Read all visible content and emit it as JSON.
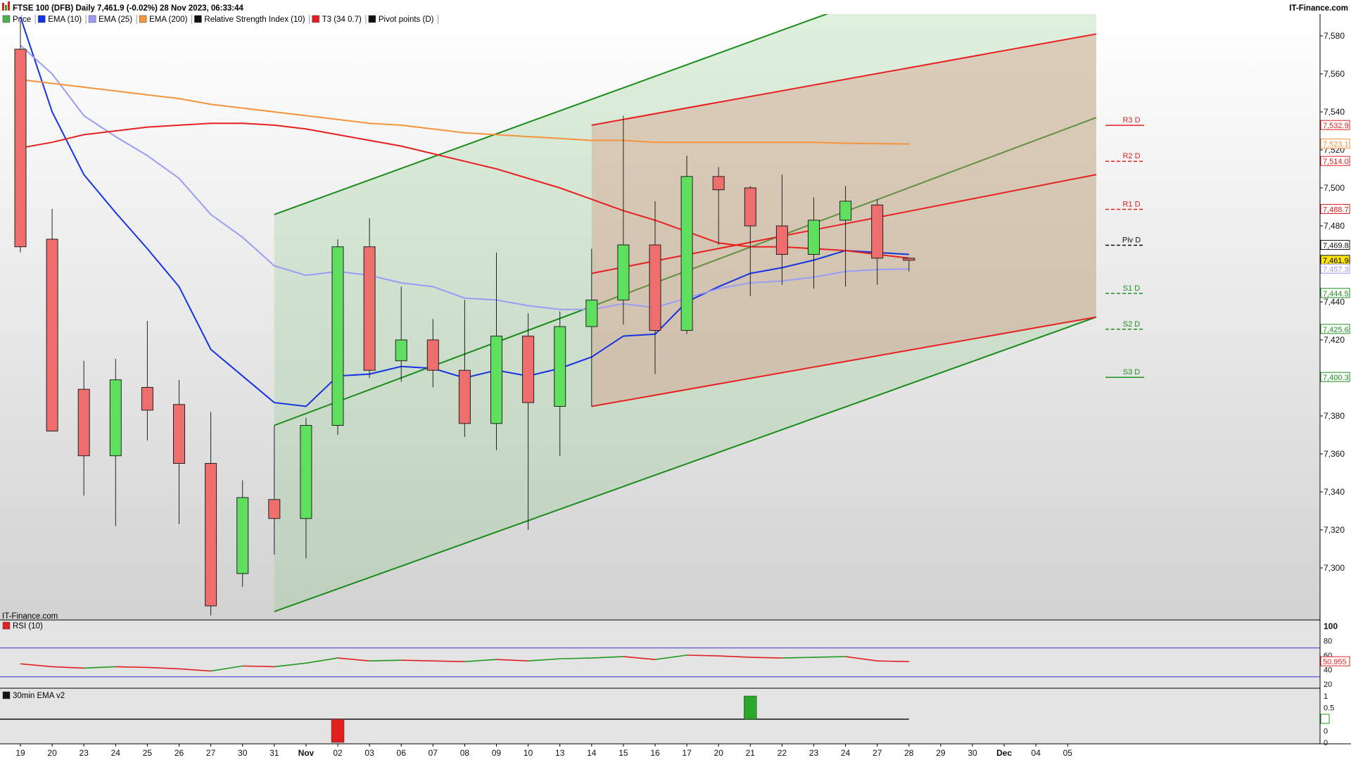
{
  "header": {
    "title": "FTSE 100 (DFB) Daily 7,461.9 (-0.02%) 28 Nov 2023, 06:33:44",
    "brand": "IT-Finance.com",
    "watermark": "IT-Finance.com"
  },
  "legend": [
    {
      "label": "Price",
      "color": "#4caf50"
    },
    {
      "label": "EMA (10)",
      "color": "#1533e0"
    },
    {
      "label": "EMA (25)",
      "color": "#9a9cf5"
    },
    {
      "label": "EMA (200)",
      "color": "#f5943a"
    },
    {
      "label": "Relative Strength Index (10)",
      "color": "#111111"
    },
    {
      "label": "T3 (34 0.7)",
      "color": "#e02020"
    },
    {
      "label": "Pivot points (D)",
      "color": "#111111"
    }
  ],
  "colors": {
    "up": "#5ee05e",
    "down": "#ee6e6e",
    "ema10": "#1533e0",
    "ema25": "#9a9cf5",
    "ema200": "#f5943a",
    "channel_green": "#1a8c1a",
    "channel_red": "#e82020",
    "panel_bg": "#d9d9d9"
  },
  "chart_data": [
    {
      "type": "candlestick",
      "panel": "price",
      "ylim": [
        7280,
        7600
      ],
      "y_ticks": [
        7300,
        7320,
        7340,
        7360,
        7380,
        7400,
        7420,
        7440,
        7460,
        7480,
        7500,
        7520,
        7540,
        7560,
        7580
      ],
      "y_tick_labels": [
        "7,300",
        "7,320",
        "7,340",
        "7,360",
        "7,380",
        "7,400",
        "7,420",
        "7,440",
        "7,460",
        "7,480",
        "7,500",
        "7,520",
        "7,540",
        "7,560",
        "7,580"
      ],
      "x_labels": [
        "19",
        "20",
        "23",
        "24",
        "25",
        "26",
        "27",
        "30",
        "31",
        "Nov",
        "02",
        "03",
        "06",
        "07",
        "08",
        "09",
        "10",
        "13",
        "14",
        "15",
        "16",
        "17",
        "20",
        "21",
        "22",
        "23",
        "24",
        "27",
        "28",
        "29",
        "30",
        "Dec",
        "04",
        "05"
      ],
      "candles": [
        {
          "o": 7573,
          "h": 7588,
          "l": 7466,
          "c": 7469
        },
        {
          "o": 7473,
          "h": 7489,
          "l": 7372,
          "c": 7372
        },
        {
          "o": 7394,
          "h": 7409,
          "l": 7338,
          "c": 7359
        },
        {
          "o": 7359,
          "h": 7410,
          "l": 7322,
          "c": 7399
        },
        {
          "o": 7395,
          "h": 7430,
          "l": 7367,
          "c": 7383
        },
        {
          "o": 7386,
          "h": 7399,
          "l": 7323,
          "c": 7355
        },
        {
          "o": 7355,
          "h": 7382,
          "l": 7275,
          "c": 7280
        },
        {
          "o": 7297,
          "h": 7346,
          "l": 7290,
          "c": 7337
        },
        {
          "o": 7336,
          "h": 7375,
          "l": 7307,
          "c": 7326
        },
        {
          "o": 7326,
          "h": 7379,
          "l": 7305,
          "c": 7375
        },
        {
          "o": 7375,
          "h": 7473,
          "l": 7370,
          "c": 7469
        },
        {
          "o": 7469,
          "h": 7484,
          "l": 7400,
          "c": 7404
        },
        {
          "o": 7409,
          "h": 7448,
          "l": 7398,
          "c": 7420
        },
        {
          "o": 7420,
          "h": 7431,
          "l": 7395,
          "c": 7404
        },
        {
          "o": 7404,
          "h": 7441,
          "l": 7369,
          "c": 7376
        },
        {
          "o": 7376,
          "h": 7466,
          "l": 7362,
          "c": 7422
        },
        {
          "o": 7422,
          "h": 7434,
          "l": 7320,
          "c": 7387
        },
        {
          "o": 7385,
          "h": 7435,
          "l": 7359,
          "c": 7427
        },
        {
          "o": 7427,
          "h": 7468,
          "l": 7385,
          "c": 7441
        },
        {
          "o": 7441,
          "h": 7538,
          "l": 7428,
          "c": 7470
        },
        {
          "o": 7470,
          "h": 7493,
          "l": 7402,
          "c": 7425
        },
        {
          "o": 7425,
          "h": 7517,
          "l": 7423,
          "c": 7506
        },
        {
          "o": 7506,
          "h": 7511,
          "l": 7470,
          "c": 7499
        },
        {
          "o": 7500,
          "h": 7501,
          "l": 7443,
          "c": 7480
        },
        {
          "o": 7480,
          "h": 7507,
          "l": 7449,
          "c": 7465
        },
        {
          "o": 7465,
          "h": 7495,
          "l": 7447,
          "c": 7483
        },
        {
          "o": 7483,
          "h": 7501,
          "l": 7448,
          "c": 7493
        },
        {
          "o": 7491,
          "h": 7494,
          "l": 7449,
          "c": 7463
        },
        {
          "o": 7463,
          "h": 7463,
          "l": 7456,
          "c": 7461.9
        }
      ],
      "series": [
        {
          "name": "EMA (10)",
          "values": [
            7590,
            7540,
            7507,
            7487,
            7468,
            7448,
            7415,
            7401,
            7387,
            7385,
            7401,
            7402,
            7406,
            7405,
            7400,
            7404,
            7401,
            7405,
            7411,
            7422,
            7423,
            7440,
            7448,
            7455,
            7458,
            7462,
            7467,
            7466,
            7465
          ]
        },
        {
          "name": "EMA (25)",
          "values": [
            7575,
            7560,
            7538,
            7527,
            7517,
            7505,
            7486,
            7474,
            7459,
            7454,
            7456,
            7454,
            7450,
            7448,
            7442,
            7441,
            7438,
            7436,
            7436,
            7439,
            7437,
            7442,
            7447,
            7450,
            7451,
            7453,
            7456,
            7457,
            7457.3
          ]
        },
        {
          "name": "EMA (200)",
          "values": [
            7557,
            7555,
            7553,
            7551,
            7549,
            7547,
            7544,
            7542,
            7540,
            7538,
            7536,
            7534,
            7533,
            7531,
            7529,
            7528,
            7527,
            7526,
            7525,
            7525,
            7524,
            7524,
            7524,
            7524,
            7524,
            7524,
            7523.5,
            7523.3,
            7523.1
          ]
        },
        {
          "name": "T3 (34 0.7)",
          "values": [
            7521,
            7524,
            7528,
            7530,
            7532,
            7533,
            7534,
            7534,
            7533,
            7531,
            7528,
            7525,
            7522,
            7518,
            7514,
            7510,
            7505,
            7500,
            7494,
            7488,
            7483,
            7477,
            7471,
            7469,
            7469,
            7468,
            7467,
            7465,
            7463
          ]
        }
      ],
      "pivots": [
        {
          "label": "R3 D",
          "value": 7532.9,
          "color": "#e02020",
          "dashed": false
        },
        {
          "label": "R2 D",
          "value": 7514.0,
          "color": "#e02020",
          "dashed": true
        },
        {
          "label": "R1 D",
          "value": 7488.7,
          "color": "#e02020",
          "dashed": true
        },
        {
          "label": "Piv D",
          "value": 7469.8,
          "color": "#111111",
          "dashed": true
        },
        {
          "label": "S1 D",
          "value": 7444.5,
          "color": "#1f8f1f",
          "dashed": true
        },
        {
          "label": "S2 D",
          "value": 7425.6,
          "color": "#1f8f1f",
          "dashed": true
        },
        {
          "label": "S3 D",
          "value": 7400.3,
          "color": "#1f8f1f",
          "dashed": false
        }
      ],
      "price_tags": [
        {
          "value": 7532.9,
          "label": "7,532.9",
          "color": "#e02020"
        },
        {
          "value": 7523.1,
          "label": "7,523.1",
          "color": "#f5943a"
        },
        {
          "value": 7514.0,
          "label": "7,514.0",
          "color": "#e02020"
        },
        {
          "value": 7488.7,
          "label": "7,488.7",
          "color": "#e02020"
        },
        {
          "value": 7469.8,
          "label": "7,469.8",
          "color": "#111111"
        },
        {
          "value": 7461.9,
          "label": "7,461.9",
          "color": "#111111",
          "highlight": true
        },
        {
          "value": 7457.3,
          "label": "7,457.3",
          "color": "#9a9cf5"
        },
        {
          "value": 7444.5,
          "label": "7,444.5",
          "color": "#1f8f1f"
        },
        {
          "value": 7425.6,
          "label": "7,425.6",
          "color": "#1f8f1f"
        },
        {
          "value": 7400.3,
          "label": "7,400.3",
          "color": "#1f8f1f"
        }
      ],
      "channels": [
        {
          "color": "green",
          "start_index": 8,
          "end_index": 33.9,
          "upper": [
            7486,
            7643
          ],
          "mid": [
            7375,
            7537
          ],
          "lower": [
            7277,
            7432
          ]
        },
        {
          "color": "red",
          "start_index": 18,
          "end_index": 33.9,
          "upper": [
            7533,
            7581
          ],
          "mid": [
            7455,
            7507
          ],
          "lower": [
            7385,
            7432
          ]
        }
      ]
    },
    {
      "type": "line",
      "panel": "RSI (10)",
      "title": "RSI (10)",
      "ylim": [
        0,
        100
      ],
      "y_ticks": [
        20,
        40,
        60,
        80,
        100
      ],
      "y_tick_labels": [
        "20",
        "40",
        "60",
        "80",
        "100"
      ],
      "levels": [
        30,
        70
      ],
      "last_value_label": "50.955",
      "values": [
        48,
        44,
        42,
        44,
        43,
        41,
        38,
        45,
        44,
        49,
        56,
        52,
        53,
        52,
        51,
        54,
        52,
        55,
        56,
        58,
        54,
        60,
        59,
        57,
        56,
        57,
        58,
        52,
        51
      ]
    },
    {
      "type": "bar",
      "panel": "30min EMA v2",
      "title": "30min EMA v2",
      "ylim": [
        -1.1,
        1.1
      ],
      "y_ticks": [
        1,
        0.5,
        0,
        -0.5,
        -1
      ],
      "y_tick_labels": [
        "1",
        "0.5",
        "0",
        "0",
        "0"
      ],
      "bars": [
        {
          "index": 10,
          "value": -1,
          "color": "#e02020"
        },
        {
          "index": 23,
          "value": 1,
          "color": "#2aa82a"
        }
      ]
    }
  ]
}
